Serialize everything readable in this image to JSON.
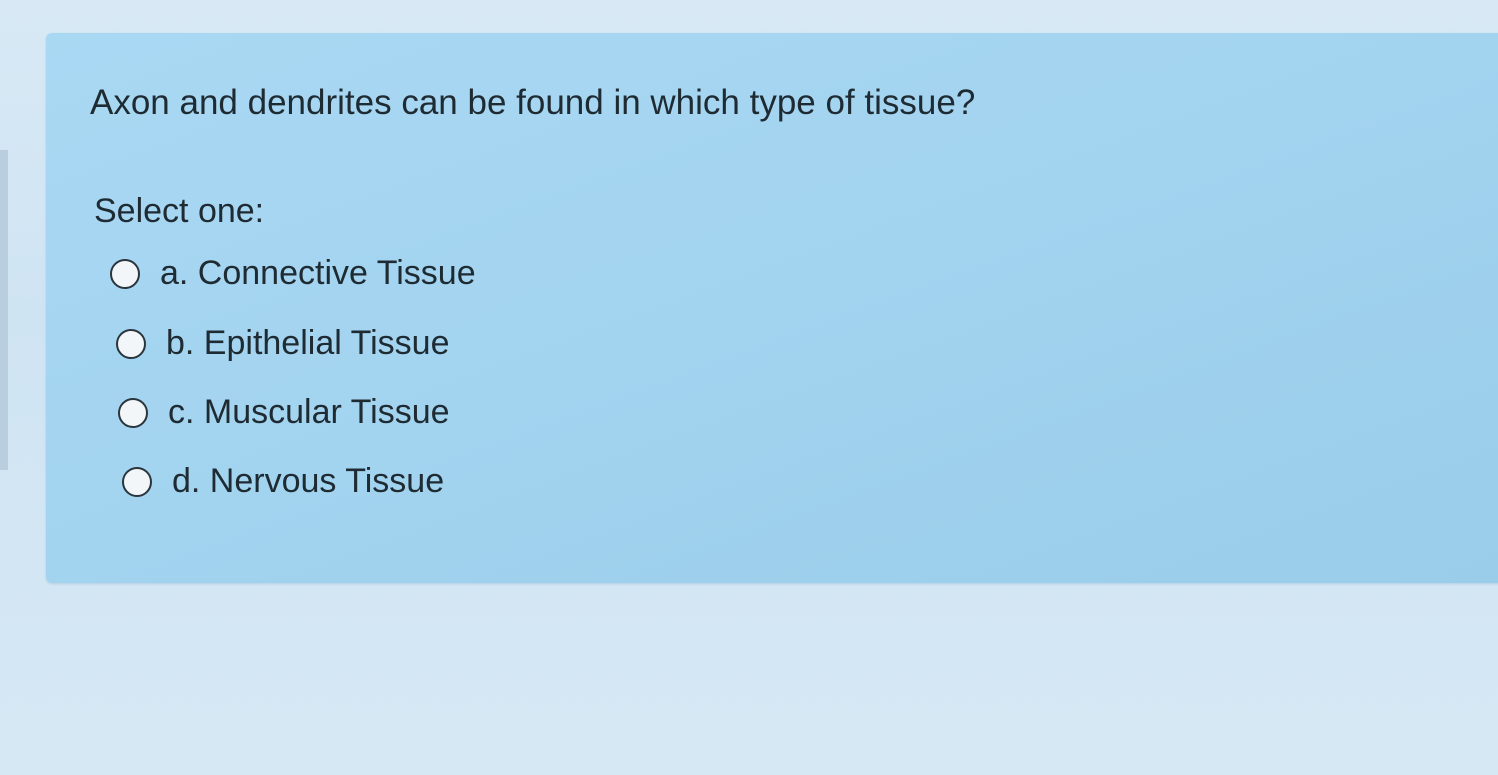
{
  "question": {
    "text": "Axon and dendrites can be found in which type of tissue?",
    "instruction": "Select one:",
    "options": [
      {
        "label": "a. Connective Tissue",
        "selected": false
      },
      {
        "label": "b. Epithelial Tissue",
        "selected": false
      },
      {
        "label": "c. Muscular Tissue",
        "selected": false
      },
      {
        "label": "d. Nervous Tissue",
        "selected": false
      }
    ]
  },
  "colors": {
    "card_background": "#a2d3ef",
    "page_background": "#d3e7f4",
    "text": "#1f2b33"
  }
}
